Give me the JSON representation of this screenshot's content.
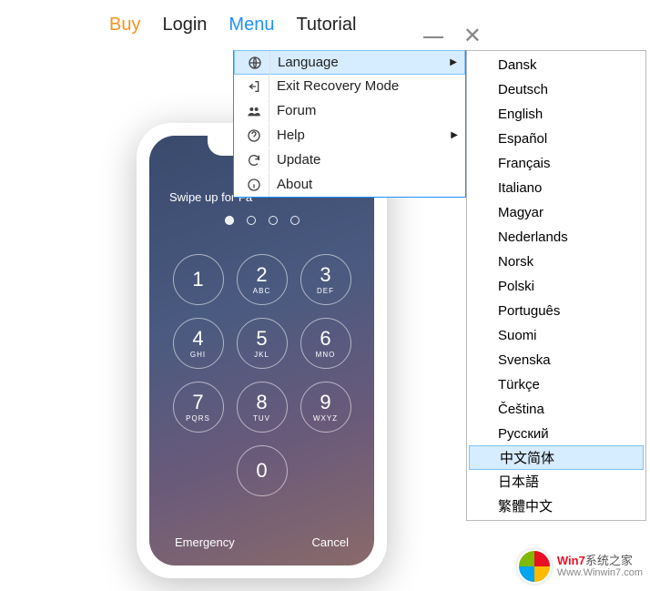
{
  "nav": {
    "buy": "Buy",
    "login": "Login",
    "menu": "Menu",
    "tutorial": "Tutorial"
  },
  "menu": {
    "items": [
      {
        "icon": "globe",
        "label": "Language",
        "submenu": true,
        "active": true
      },
      {
        "icon": "exit",
        "label": "Exit Recovery Mode"
      },
      {
        "icon": "people",
        "label": "Forum"
      },
      {
        "icon": "help",
        "label": "Help",
        "submenu": true
      },
      {
        "icon": "refresh",
        "label": "Update"
      },
      {
        "icon": "info",
        "label": "About"
      }
    ]
  },
  "languages": [
    "Dansk",
    "Deutsch",
    "English",
    "Español",
    "Français",
    "Italiano",
    "Magyar",
    "Nederlands",
    "Norsk",
    "Polski",
    "Português",
    "Suomi",
    "Svenska",
    "Türkçe",
    "Čeština",
    "Русский",
    "中文简体",
    "日本語",
    "繁體中文"
  ],
  "language_active_index": 16,
  "phone": {
    "swipe": "Swipe up for Fa",
    "keys": [
      {
        "n": "1",
        "l": ""
      },
      {
        "n": "2",
        "l": "ABC"
      },
      {
        "n": "3",
        "l": "DEF"
      },
      {
        "n": "4",
        "l": "GHI"
      },
      {
        "n": "5",
        "l": "JKL"
      },
      {
        "n": "6",
        "l": "MNO"
      },
      {
        "n": "7",
        "l": "PQRS"
      },
      {
        "n": "8",
        "l": "TUV"
      },
      {
        "n": "9",
        "l": "WXYZ"
      },
      {
        "n": "0",
        "l": ""
      }
    ],
    "emergency": "Emergency",
    "cancel": "Cancel"
  },
  "watermark": {
    "brand_prefix": "Win7",
    "brand_suffix": "系统之家",
    "url": "Www.Winwin7.com"
  }
}
